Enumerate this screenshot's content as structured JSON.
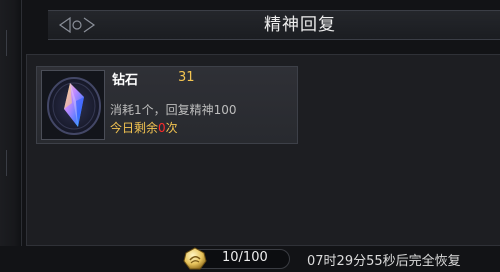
{
  "title": "精神回复",
  "item": {
    "name": "钻石",
    "count": "31",
    "description": "消耗1个，回复精神100",
    "limit_prefix": "今日剩余",
    "limit_value": "0",
    "limit_suffix": "次"
  },
  "energy": {
    "value": "10/100"
  },
  "recover_text": "07时29分55秒后完全恢复",
  "colors": {
    "accent_gold": "#f3c451",
    "accent_red": "#ff2b2b"
  },
  "icons": {
    "item": "diamond-crystal-icon",
    "energy": "energy-coin-icon",
    "ornament": "title-ornament-icon"
  }
}
